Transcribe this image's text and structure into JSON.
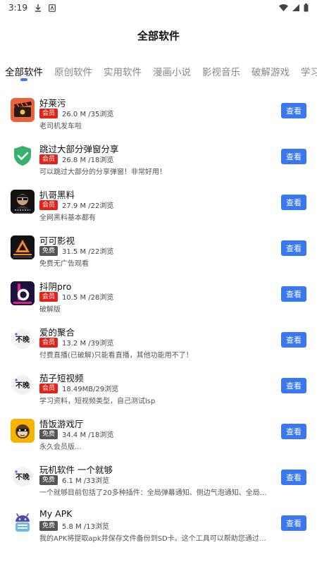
{
  "status_bar": {
    "time": "3:19"
  },
  "header": {
    "title": "全部软件"
  },
  "tabs": [
    {
      "label": "全部软件",
      "active": true
    },
    {
      "label": "原创软件"
    },
    {
      "label": "实用软件"
    },
    {
      "label": "漫画小说"
    },
    {
      "label": "影视音乐"
    },
    {
      "label": "破解游戏"
    },
    {
      "label": "学习资料"
    }
  ],
  "colors": {
    "accent": "#3a78f2",
    "vip_badge": "#e2231a",
    "free_badge": "#555555"
  },
  "apps": [
    {
      "name": "好莱污",
      "badge": "会员",
      "badge_type": "vip",
      "stats": "26.0 M /35浏览",
      "desc": "老司机发车啦",
      "icon": "film-clapper-icon",
      "button": "查看"
    },
    {
      "name": "跳过大部分弹窗分享",
      "badge": "会员",
      "badge_type": "vip",
      "stats": "26.8 M /18浏览",
      "desc": "可以跳过大部分的分享弹窗！非常好用！",
      "icon": "shield-check-icon",
      "button": "查看"
    },
    {
      "name": "扒哥黑料",
      "badge": "会员",
      "badge_type": "vip",
      "stats": "27.9 M /22浏览",
      "desc": "全网黑料基本都有",
      "icon": "avatar-sunglasses-icon",
      "button": "查看"
    },
    {
      "name": "可可影视",
      "badge": "免费",
      "badge_type": "free",
      "stats": "31.5 M /22浏览",
      "desc": "免费无广告观看",
      "icon": "kk-logo-icon",
      "button": "查看"
    },
    {
      "name": "抖阴pro",
      "badge": "会员",
      "badge_type": "vip",
      "stats": "10.5 M /28浏览",
      "desc": "破解版",
      "icon": "b-logo-icon",
      "button": "查看"
    },
    {
      "name": "爱的聚合",
      "badge": "会员",
      "badge_type": "vip",
      "stats": "13.2 M /39浏览",
      "desc": "付费直播(已破解)只能看直播，其他功能用不了！",
      "icon": "bubi-logo-icon",
      "button": "查看"
    },
    {
      "name": "茄子短视频",
      "badge": "会员",
      "badge_type": "vip",
      "stats": "18.49MB/29浏览",
      "desc": "学习资料，短视频类型，自己测试lsp",
      "icon": "bubi-logo-icon",
      "button": "查看"
    },
    {
      "name": "悟饭游戏厅",
      "badge": "免费",
      "badge_type": "free",
      "stats": "34.4 M /18浏览",
      "desc": "永久会员版...",
      "icon": "monkey-logo-icon",
      "button": "查看"
    },
    {
      "name": "玩机软件 一个就够",
      "badge": "免费",
      "badge_type": "free",
      "stats": "6.1 M /33浏览",
      "desc": "一个就够目前包括了20多种插件：全局弹幕通知、侧边气泡通知、全局透明壁纸、...",
      "icon": "bubi-logo-icon",
      "button": "查看"
    },
    {
      "name": "My APK",
      "badge": "免费",
      "badge_type": "free",
      "stats": "5.8 M /13浏览",
      "desc": "我的APK将提取apk并保存文件备份到SD卡。这个工具可以帮助您通过蓝牙，电子...",
      "icon": "android-robot-icon",
      "button": "查看"
    }
  ]
}
